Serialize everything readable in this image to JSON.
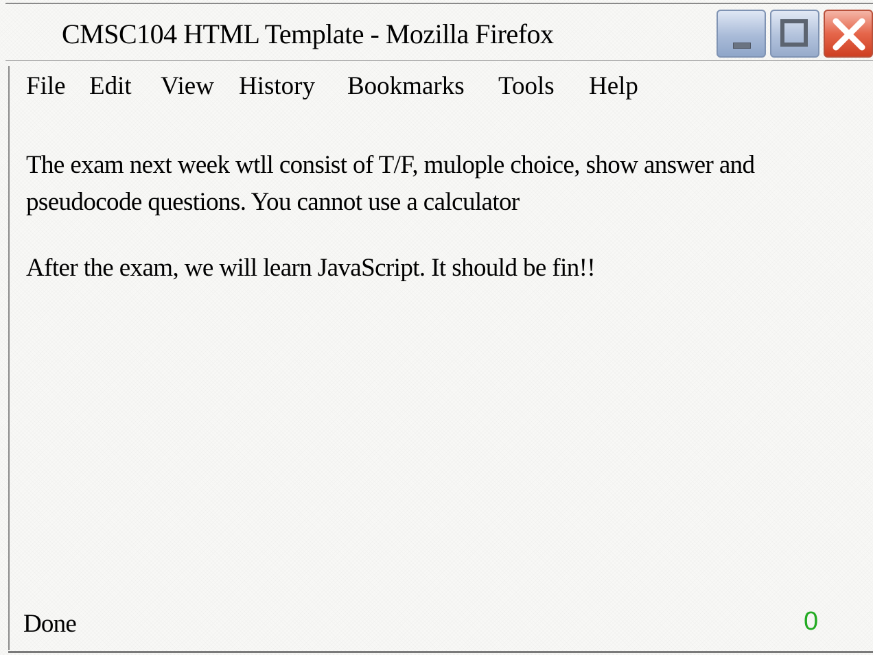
{
  "window": {
    "title": "CMSC104 HTML Template - Mozilla Firefox",
    "controls": {
      "minimize_icon": "minimize-icon",
      "maximize_icon": "maximize-icon",
      "close_icon": "close-icon"
    }
  },
  "menu": {
    "items": [
      {
        "label": "File"
      },
      {
        "label": "Edit"
      },
      {
        "label": "View"
      },
      {
        "label": "History"
      },
      {
        "label": "Bookmarks"
      },
      {
        "label": "Tools"
      },
      {
        "label": "Help"
      }
    ]
  },
  "content": {
    "paragraph1": "The exam next week wtll consist of T/F, mulople choice, show answer and pseudocode questions. You cannot use a calculator",
    "paragraph2": "After the exam, we will learn JavaScript. It should be fin!!"
  },
  "status_bar": {
    "status": "Done",
    "counter": "0",
    "counter_color": "#22aa22"
  }
}
